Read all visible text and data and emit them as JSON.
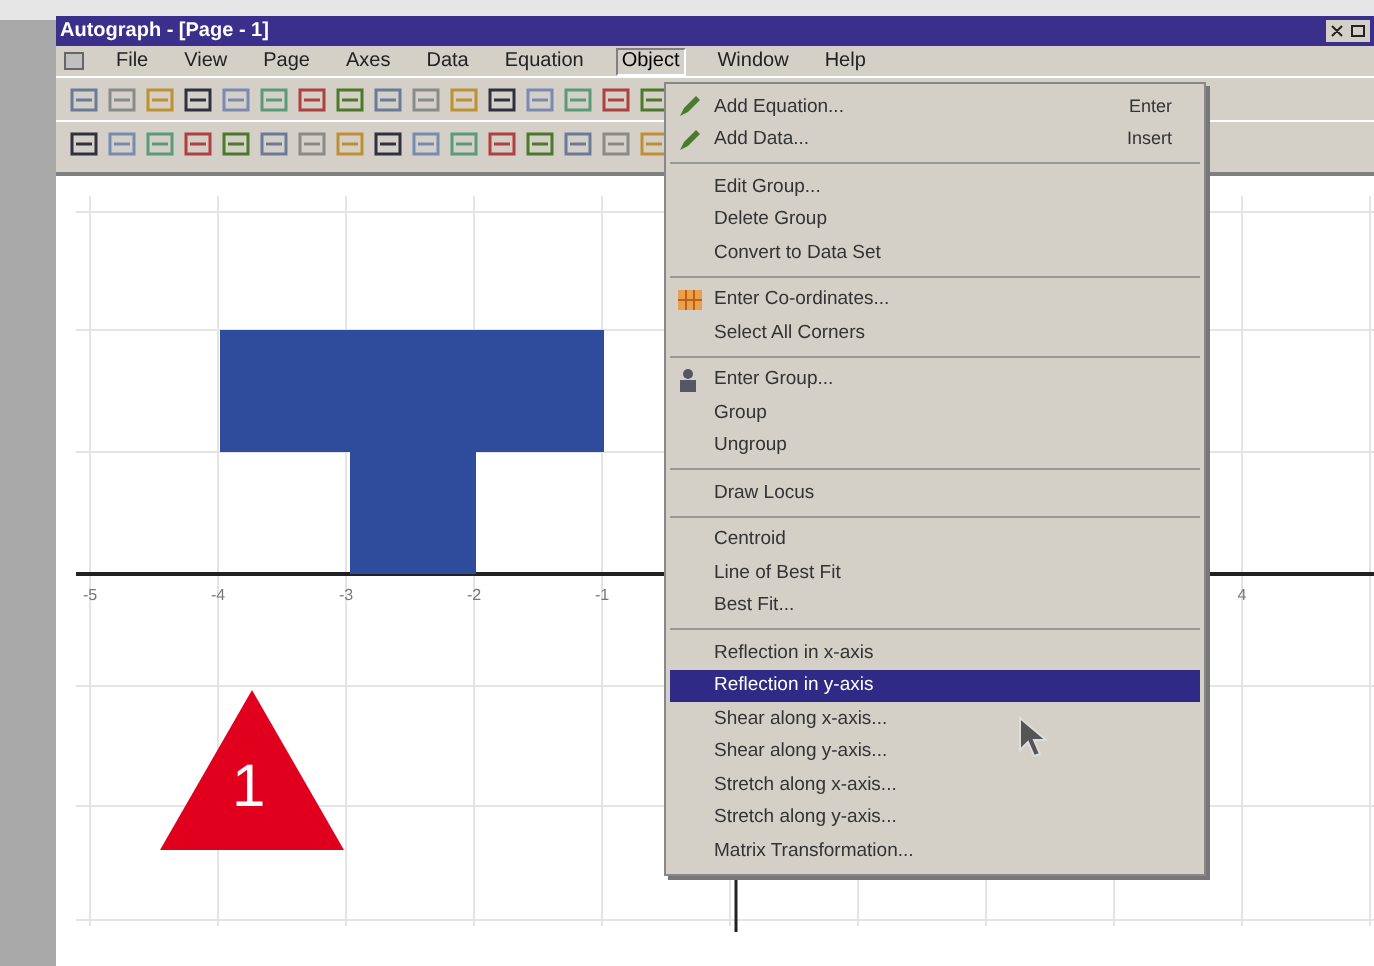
{
  "window": {
    "title": "Autograph - [Page - 1]"
  },
  "menu_bar": [
    {
      "label": "File",
      "selected": false
    },
    {
      "label": "View",
      "selected": false
    },
    {
      "label": "Page",
      "selected": false
    },
    {
      "label": "Axes",
      "selected": false
    },
    {
      "label": "Data",
      "selected": false
    },
    {
      "label": "Equation",
      "selected": false
    },
    {
      "label": "Object",
      "selected": true
    },
    {
      "label": "Window",
      "selected": false
    },
    {
      "label": "Help",
      "selected": false
    }
  ],
  "graph": {
    "x_tick_labels": [
      "-5",
      "-4",
      "-3",
      "-2",
      "-1",
      "4"
    ]
  },
  "object_menu": {
    "groups": [
      {
        "items": [
          {
            "label": "Add Equation...",
            "shortcut": "Enter",
            "kind": "equation",
            "selected": false
          },
          {
            "label": "Add Data...",
            "shortcut": "Insert",
            "kind": "data",
            "selected": false
          }
        ]
      },
      {
        "items": [
          {
            "label": "Edit Group...",
            "kind": "plain",
            "selected": false
          },
          {
            "label": "Delete Group",
            "kind": "plain",
            "selected": false
          },
          {
            "label": "Convert to Data Set",
            "kind": "plain",
            "selected": false
          }
        ]
      },
      {
        "items": [
          {
            "label": "Enter Co-ordinates...",
            "kind": "coordinates",
            "selected": false
          },
          {
            "label": "Select All Corners",
            "kind": "plain",
            "selected": false
          }
        ]
      },
      {
        "items": [
          {
            "label": "Enter Group...",
            "kind": "group",
            "selected": false
          },
          {
            "label": "Group",
            "kind": "plain",
            "selected": false
          },
          {
            "label": "Ungroup",
            "kind": "plain",
            "selected": false
          }
        ]
      },
      {
        "items": [
          {
            "label": "Draw Locus",
            "kind": "plain",
            "selected": false
          }
        ]
      },
      {
        "items": [
          {
            "label": "Centroid",
            "kind": "plain",
            "selected": false
          },
          {
            "label": "Line of Best Fit",
            "kind": "plain",
            "selected": false
          },
          {
            "label": "Best Fit...",
            "kind": "plain",
            "selected": false
          }
        ]
      },
      {
        "items": [
          {
            "label": "Reflection in x-axis",
            "kind": "plain",
            "selected": false
          },
          {
            "label": "Reflection in y-axis",
            "kind": "plain",
            "selected": true
          },
          {
            "label": "Shear along x-axis...",
            "kind": "plain",
            "selected": false
          },
          {
            "label": "Shear along y-axis...",
            "kind": "plain",
            "selected": false
          },
          {
            "label": "Stretch along x-axis...",
            "kind": "plain",
            "selected": false
          },
          {
            "label": "Stretch along y-axis...",
            "kind": "plain",
            "selected": false
          },
          {
            "label": "Matrix Transformation...",
            "kind": "plain",
            "selected": false
          }
        ]
      }
    ]
  },
  "badge": {
    "label": "1"
  }
}
